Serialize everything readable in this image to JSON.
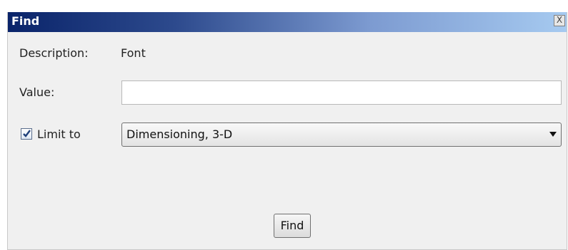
{
  "dialog": {
    "title": "Find",
    "close_label": "X"
  },
  "form": {
    "description_label": "Description:",
    "description_value": "Font",
    "value_label": "Value:",
    "value_input": "",
    "limit_checkbox_checked": true,
    "limit_label": "Limit to",
    "limit_selected": "Dimensioning, 3-D"
  },
  "buttons": {
    "find_label": "Find"
  }
}
